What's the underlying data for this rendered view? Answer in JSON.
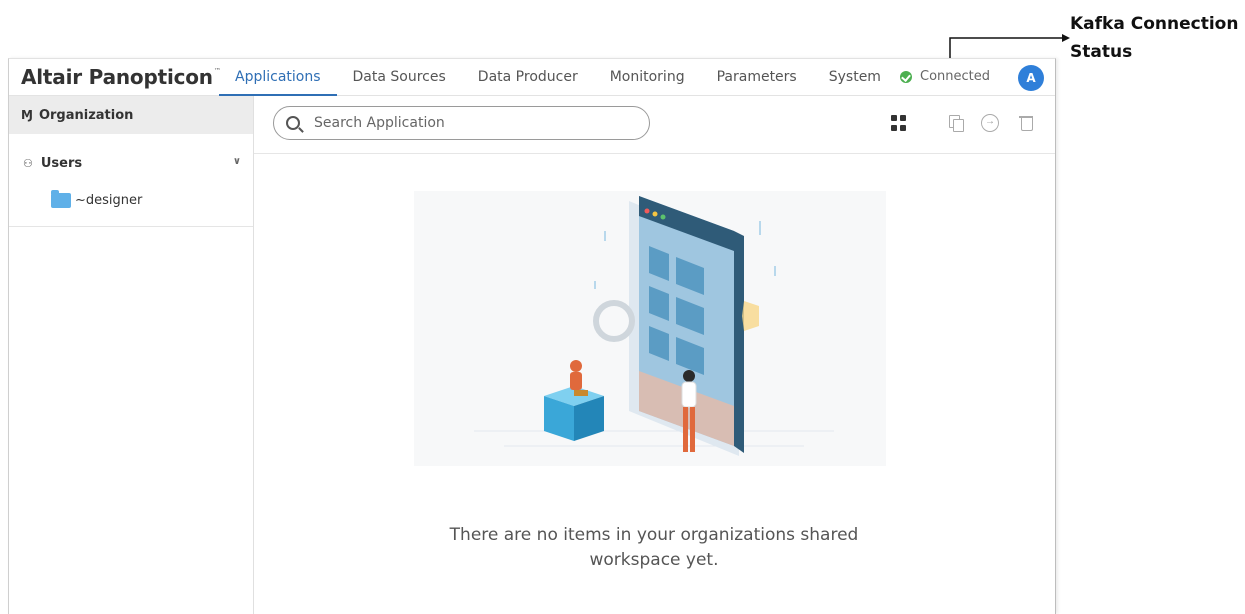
{
  "annotation": {
    "line1": "Kafka Connection",
    "line2": "Status"
  },
  "header": {
    "logo": "Altair Panopticon",
    "logo_mark": "™",
    "nav": [
      {
        "label": "Applications",
        "active": true
      },
      {
        "label": "Data Sources"
      },
      {
        "label": "Data Producer"
      },
      {
        "label": "Monitoring"
      },
      {
        "label": "Parameters"
      },
      {
        "label": "System"
      }
    ],
    "status": "Connected",
    "avatar_initial": "A"
  },
  "sidebar": {
    "organization": "Organization",
    "users": "Users",
    "folder": "~designer"
  },
  "main": {
    "search_placeholder": "Search Application",
    "empty_line1": "There are no items in your organizations shared",
    "empty_line2": "workspace yet."
  },
  "colors": {
    "accent": "#2f6fb5",
    "status_ok": "#4caf50",
    "avatar": "#2f7fd9",
    "folder": "#5fb0e8"
  }
}
